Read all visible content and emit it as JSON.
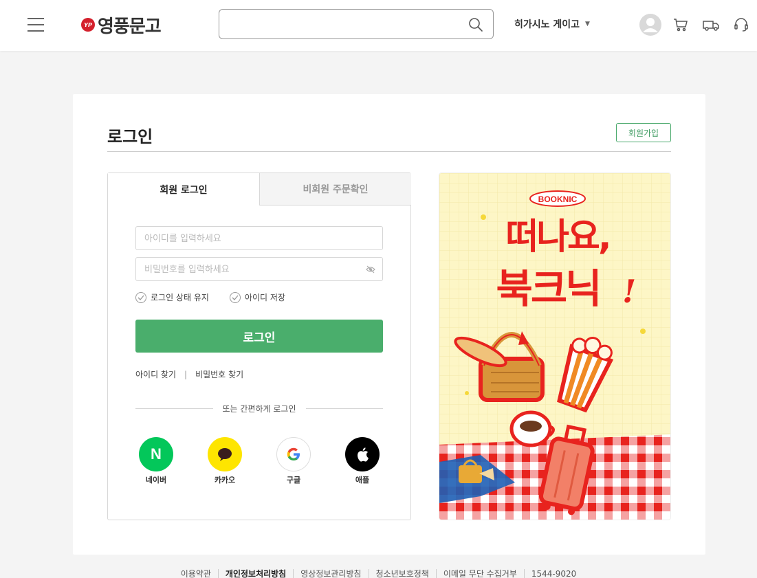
{
  "header": {
    "logo_mark": "YP",
    "logo_text": "영풍문고",
    "search_placeholder": "",
    "store_label": "히가시노 게이고"
  },
  "login": {
    "title": "로그인",
    "signup_label": "회원가입",
    "tabs": [
      {
        "label": "회원 로그인",
        "active": true
      },
      {
        "label": "비회원 주문확인",
        "active": false
      }
    ],
    "id_placeholder": "아이디를 입력하세요",
    "pw_placeholder": "비밀번호를 입력하세요",
    "keep_login_label": "로그인 상태 유지",
    "save_id_label": "아이디 저장",
    "submit_label": "로그인",
    "find_id_label": "아이디 찾기",
    "find_pw_label": "비밀번호 찾기",
    "link_separator": "|",
    "easy_login_label": "또는 간편하게 로그인",
    "social": [
      {
        "name": "네이버",
        "glyph": "N",
        "color": "#03c75a"
      },
      {
        "name": "카카오",
        "color": "#fee500"
      },
      {
        "name": "구글",
        "glyph": "G",
        "color": "#ffffff"
      },
      {
        "name": "애플",
        "color": "#000000"
      }
    ]
  },
  "banner": {
    "badge": "BOOKNIC",
    "headline_1": "떠나요,",
    "headline_2": "북크닉",
    "exclaim": "!"
  },
  "footer": {
    "links": [
      "이용약관",
      "개인정보처리방침",
      "영상정보관리방침",
      "청소년보호정책",
      "이메일 무단 수집거부",
      "1544-9020"
    ]
  },
  "colors": {
    "accent_green": "#4aae6c",
    "banner_bg": "#fdf6c6",
    "banner_red": "#e8231e"
  }
}
